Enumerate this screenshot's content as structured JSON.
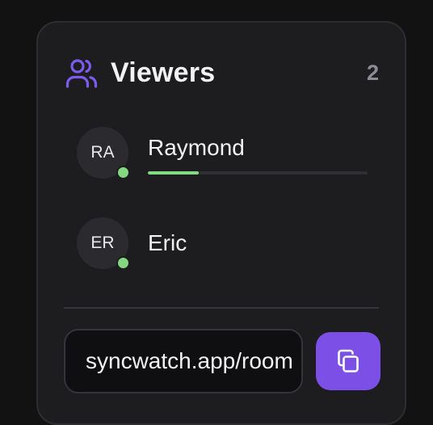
{
  "colors": {
    "accent": "#7c4fe6",
    "online": "#84d882",
    "panel_bg": "#1d1d20"
  },
  "viewers_panel": {
    "title": "Viewers",
    "count": "2",
    "icon": "users-icon",
    "viewers": [
      {
        "initials": "RA",
        "name": "Raymond",
        "status": "online",
        "progress": 0.23
      },
      {
        "initials": "ER",
        "name": "Eric",
        "status": "online"
      }
    ]
  },
  "share": {
    "link_value": "syncwatch.app/room",
    "copy_icon": "copy-icon"
  }
}
